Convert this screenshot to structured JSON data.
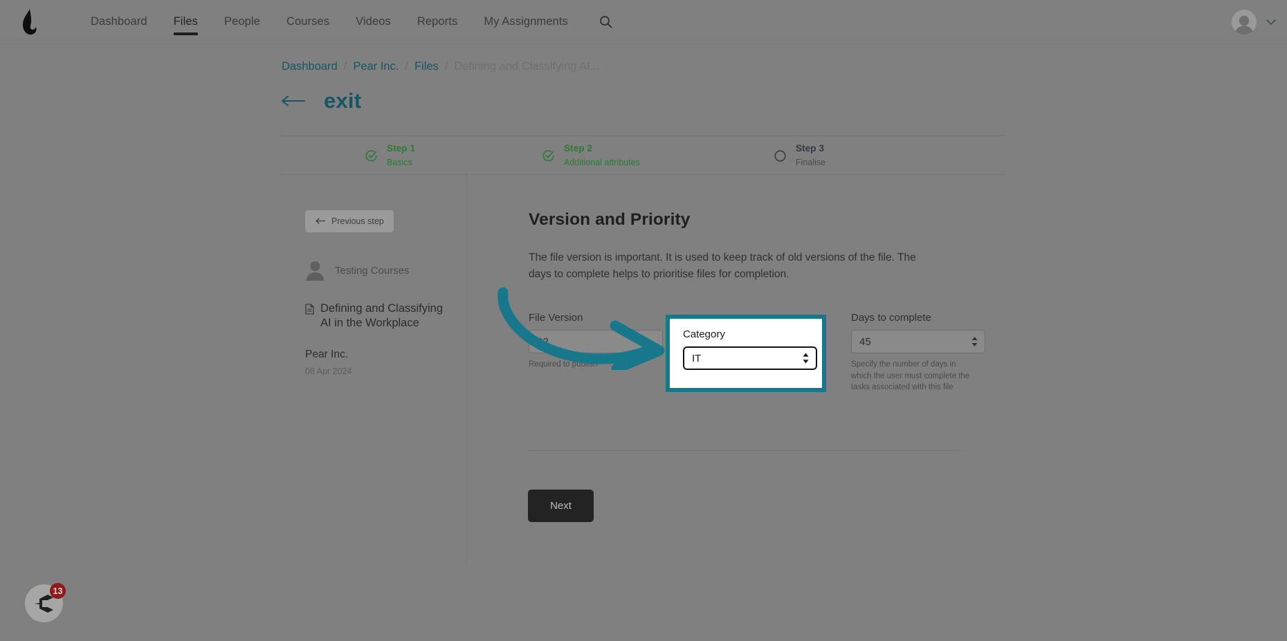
{
  "topnav": {
    "logo_icon": "flame-logo-icon",
    "items": [
      {
        "label": "Dashboard",
        "active": false
      },
      {
        "label": "Files",
        "active": true
      },
      {
        "label": "People",
        "active": false
      },
      {
        "label": "Courses",
        "active": false
      },
      {
        "label": "Videos",
        "active": false
      },
      {
        "label": "Reports",
        "active": false
      },
      {
        "label": "My Assignments",
        "active": false
      }
    ],
    "search_icon": "search-icon",
    "avatar_icon": "user-avatar-icon",
    "caret_icon": "chevron-down-icon"
  },
  "breadcrumb": {
    "items": [
      {
        "label": "Dashboard",
        "current": false
      },
      {
        "label": "Pear Inc.",
        "current": false
      },
      {
        "label": "Files",
        "current": false
      },
      {
        "label": "Defining and Classifying AI...",
        "current": true
      }
    ],
    "separator": "/"
  },
  "exit": {
    "arrow_icon": "arrow-left-icon",
    "label": "exit"
  },
  "stepper": {
    "steps": [
      {
        "title": "Step 1",
        "subtitle": "Basics",
        "state": "done",
        "icon": "check-circle-icon"
      },
      {
        "title": "Step 2",
        "subtitle": "Additional attributes",
        "state": "done",
        "icon": "check-circle-icon"
      },
      {
        "title": "Step 3",
        "subtitle": "Finalise",
        "state": "todo",
        "icon": "empty-circle-icon"
      }
    ]
  },
  "sidebar": {
    "previous_step": {
      "label": "Previous step",
      "arrow_icon": "arrow-left-icon"
    },
    "owner": {
      "name": "Testing Courses",
      "avatar_icon": "user-avatar-icon"
    },
    "file": {
      "icon": "file-document-icon",
      "title": "Defining and Classifying AI in the Workplace",
      "org": "Pear Inc.",
      "date": "08 Apr 2024"
    }
  },
  "main": {
    "heading": "Version and Priority",
    "description": "The file version is important. It is used to keep track of old versions of the file. The days to complete helps to prioritise files for completion.",
    "fields": {
      "version": {
        "label": "File Version",
        "value": "02",
        "help": "Required to publish"
      },
      "category": {
        "label": "Category",
        "value": "IT",
        "options": [
          "IT"
        ],
        "arrows_icon": "select-arrows-icon"
      },
      "days_to_complete": {
        "label": "Days to complete",
        "value": "45",
        "help": "Specify the number of days in which the user must complete the tasks associated with this file",
        "arrows_icon": "spinner-arrows-icon"
      }
    },
    "next_button": "Next"
  },
  "chat": {
    "icon": "chat-widget-icon",
    "badge": "13"
  },
  "annotation": {
    "arrow_icon": "curved-arrow-right-icon",
    "color": "#17788c"
  },
  "colors": {
    "accent_teal": "#17788c",
    "link_teal": "#17555f",
    "step_done_green": "#2c7a33",
    "badge_red": "#8e1a1a",
    "button_dark": "#232323"
  }
}
